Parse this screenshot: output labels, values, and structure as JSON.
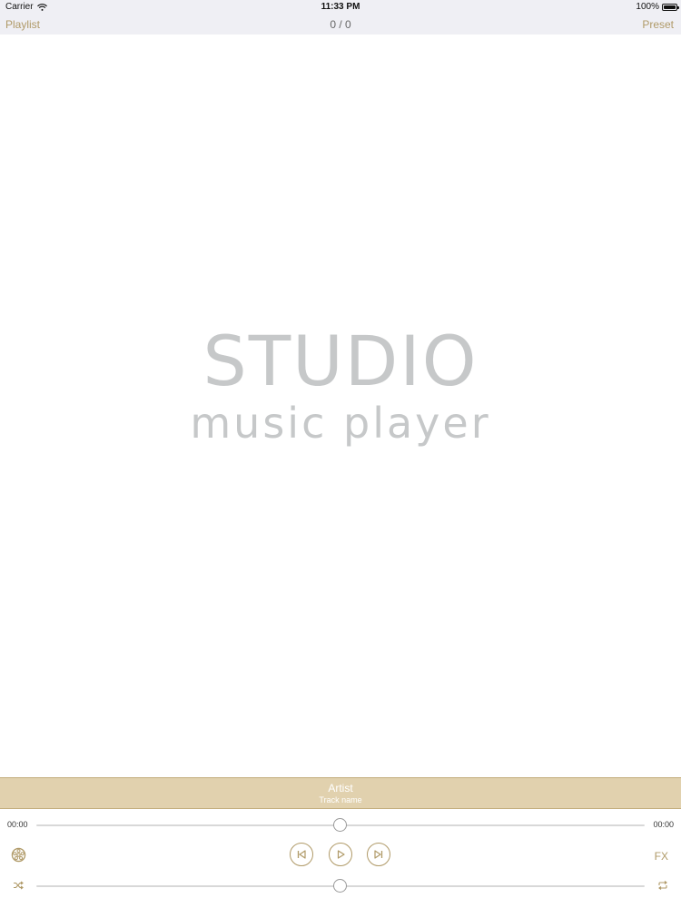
{
  "status_bar": {
    "carrier": "Carrier",
    "time": "11:33 PM",
    "battery_label": "100%",
    "battery_level": 1.0,
    "wifi_icon": "wifi-icon",
    "battery_icon": "battery-icon"
  },
  "nav": {
    "left_label": "Playlist",
    "counter": "0 / 0",
    "right_label": "Preset"
  },
  "artwork": {
    "logo_title": "STUDIO",
    "logo_subtitle": "music player"
  },
  "track": {
    "artist": "Artist",
    "track_name": "Track name"
  },
  "playback": {
    "elapsed": "00:00",
    "remaining": "00:00",
    "progress": 0.5,
    "volume": 0.5
  },
  "controls": {
    "fx_label": "FX",
    "settings_icon": "settings-wheel-icon",
    "prev_icon": "skip-previous-icon",
    "play_icon": "play-icon",
    "next_icon": "skip-next-icon",
    "shuffle_icon": "shuffle-icon",
    "repeat_icon": "repeat-icon"
  },
  "colors": {
    "accent": "#b09a68",
    "track_bar_bg": "#e1d1ae",
    "logo_gray": "#c6c8c9",
    "header_bg": "#efeff4"
  }
}
